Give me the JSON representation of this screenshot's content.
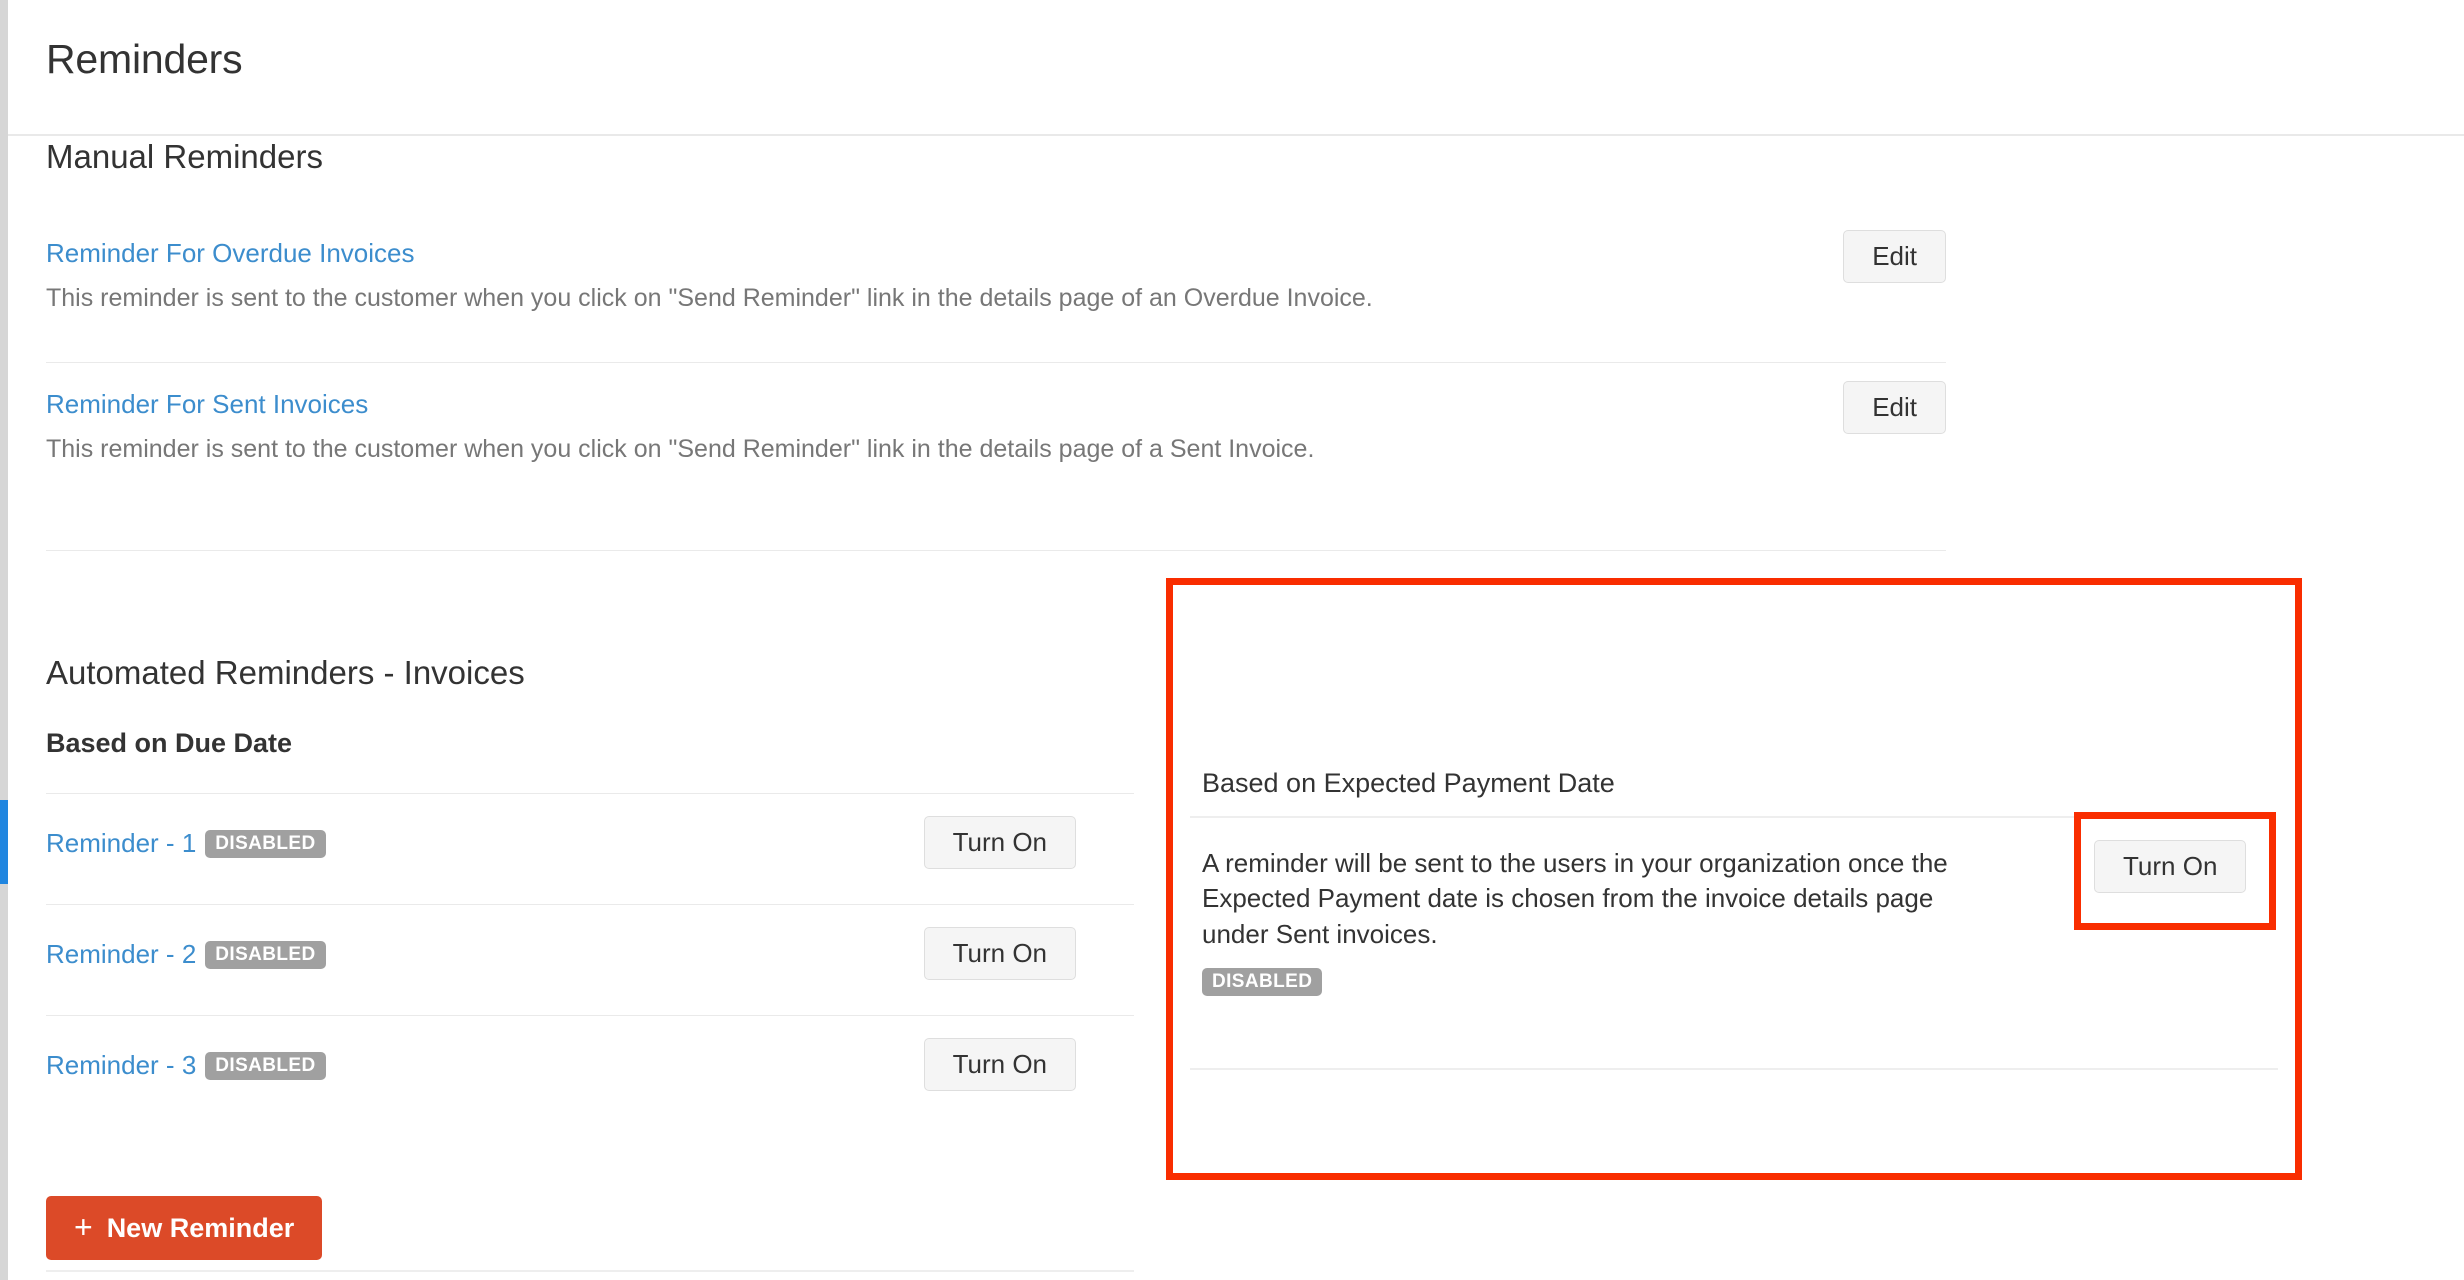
{
  "header": {
    "title": "Reminders"
  },
  "manual": {
    "heading": "Manual Reminders",
    "rows": [
      {
        "link": "Reminder For Overdue Invoices",
        "description": "This reminder is sent to the customer when you click on \"Send Reminder\" link in the details page of an Overdue Invoice.",
        "action": "Edit"
      },
      {
        "link": "Reminder For Sent Invoices",
        "description": "This reminder is sent to the customer when you click on \"Send Reminder\" link in the details page of a Sent Invoice.",
        "action": "Edit"
      }
    ]
  },
  "automated": {
    "heading": "Automated Reminders - Invoices",
    "due_date_heading": "Based on Due Date",
    "reminders": [
      {
        "link": "Reminder - 1",
        "status": "DISABLED",
        "action": "Turn On"
      },
      {
        "link": "Reminder - 2",
        "status": "DISABLED",
        "action": "Turn On"
      },
      {
        "link": "Reminder - 3",
        "status": "DISABLED",
        "action": "Turn On"
      }
    ],
    "new_reminder_label": "New Reminder",
    "new_reminder_icon": "plus-icon"
  },
  "expected_payment": {
    "heading": "Based on Expected Payment Date",
    "description": "A reminder will be sent to the users in your organization once the Expected Payment date is chosen from the invoice details page under Sent invoices.",
    "status": "DISABLED",
    "action": "Turn On"
  },
  "colors": {
    "link": "#3c8dcd",
    "primary_button": "#dc4a28",
    "badge": "#a0a0a0",
    "highlight": "#f92d00",
    "scroll_thumb": "#2086e0"
  }
}
